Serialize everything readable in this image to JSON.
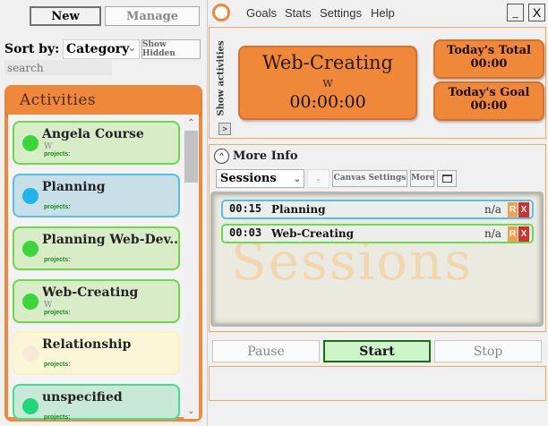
{
  "left": {
    "new_label": "New",
    "manage_label": "Manage",
    "sort_label": "Sort by:",
    "sort_value": "Category",
    "show_hidden_label": "Show Hidden",
    "search_placeholder": "search",
    "activities_title": "Activities",
    "activities": [
      {
        "name": "Angela Course",
        "sub": "W",
        "projects": "projects:",
        "color": "#3cd63c",
        "bg": "#d8ecc8",
        "border": "#6cd84a"
      },
      {
        "name": "Planning",
        "sub": "",
        "projects": "projects:",
        "color": "#20b4e8",
        "bg": "#c8dfe8",
        "border": "#58c0e8"
      },
      {
        "name": "Planning Web-Dev..",
        "sub": "",
        "projects": "projects:",
        "color": "#3cd63c",
        "bg": "#d8ecc8",
        "border": "#6cd84a"
      },
      {
        "name": "Web-Creating",
        "sub": "W",
        "projects": "projects:",
        "color": "#3cd63c",
        "bg": "#d8ecc8",
        "border": "#6cd84a"
      },
      {
        "name": "Relationship",
        "sub": "",
        "projects": "projects:",
        "color": "#f8e8d8",
        "bg": "#fbf6d8",
        "border": "#faf0c0"
      },
      {
        "name": "unspecified",
        "sub": "",
        "projects": "projects:",
        "color": "#20d878",
        "bg": "#c8e8d8",
        "border": "#40e090"
      }
    ]
  },
  "menu": {
    "items": [
      "Goals",
      "Stats",
      "Settings",
      "Help"
    ],
    "minimize": "_",
    "close": "X"
  },
  "timer": {
    "show_activities": "Show activities",
    "show_activities_arrow": ">",
    "current_name": "Web-Creating",
    "current_sub": "W",
    "current_time": "00:00:00",
    "total_label": "Today's Total",
    "total_value": "00:00",
    "goal_label": "Today's Goal",
    "goal_value": "00:00"
  },
  "info": {
    "toggle_icon": "^",
    "title": "More Info",
    "view_select": "Sessions",
    "canvas_settings": "Canvas Settings",
    "more": "More",
    "watermark": "Sessions",
    "sessions": [
      {
        "time": "00:15",
        "name": "Planning",
        "value": "n/a",
        "r": "R",
        "x": "X",
        "border": "#58c0e8"
      },
      {
        "time": "00:03",
        "name": "Web-Creating",
        "value": "n/a",
        "r": "R",
        "x": "X",
        "border": "#6cd84a"
      }
    ]
  },
  "controls": {
    "pause": "Pause",
    "start": "Start",
    "stop": "Stop"
  }
}
